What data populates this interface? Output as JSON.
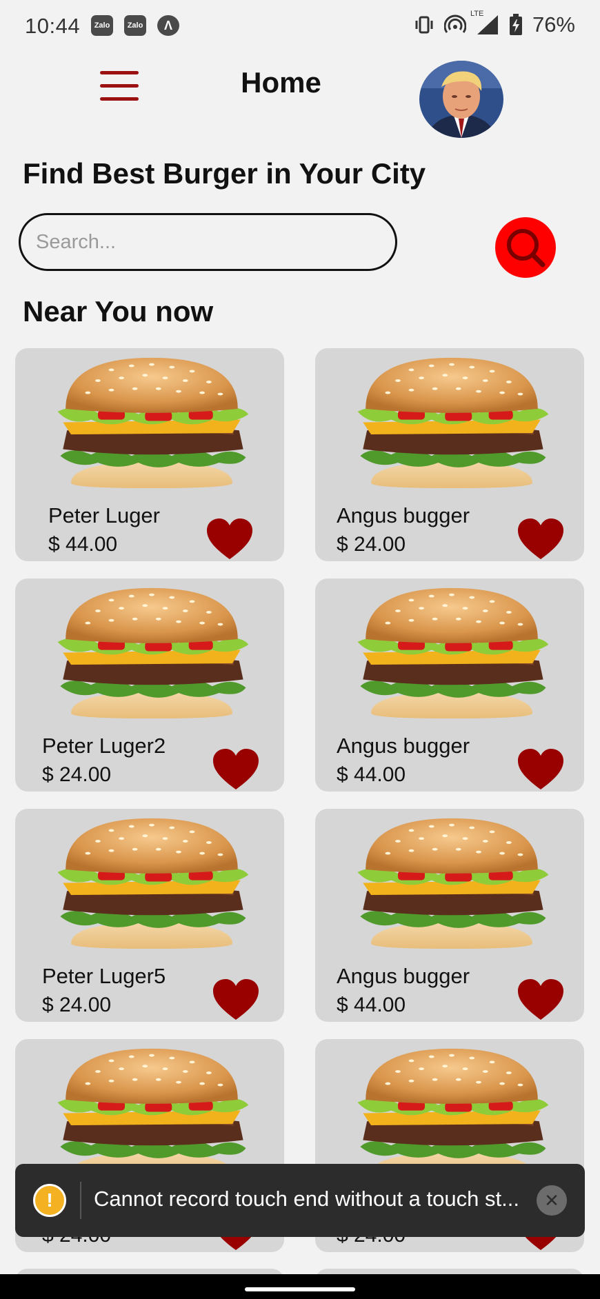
{
  "status_bar": {
    "time": "10:44",
    "left_icons": [
      "Zalo",
      "Zalo",
      "Λ"
    ],
    "network": "LTE",
    "battery": "76%"
  },
  "header": {
    "title": "Home",
    "menu_icon": "hamburger-icon",
    "avatar": "user-avatar"
  },
  "headline": "Find Best Burger in Your City",
  "search": {
    "placeholder": "Search...",
    "value": ""
  },
  "section_title": "Near You now",
  "products": [
    {
      "name": "Peter Luger",
      "price": "$ 44.00"
    },
    {
      "name": "Angus bugger",
      "price": "$ 24.00"
    },
    {
      "name": "Peter Luger2",
      "price": "$ 24.00"
    },
    {
      "name": "Angus bugger",
      "price": "$ 44.00"
    },
    {
      "name": "Peter Luger5",
      "price": "$ 24.00"
    },
    {
      "name": "Angus bugger",
      "price": "$ 44.00"
    },
    {
      "name": "",
      "price": "$ 24.00"
    },
    {
      "name": "",
      "price": "$ 24.00"
    }
  ],
  "toast": {
    "message": "Cannot record touch end without a touch st..."
  },
  "colors": {
    "accent": "#9b1010",
    "search_button": "#ff0000",
    "heart": "#990000",
    "card": "#d6d6d6"
  }
}
